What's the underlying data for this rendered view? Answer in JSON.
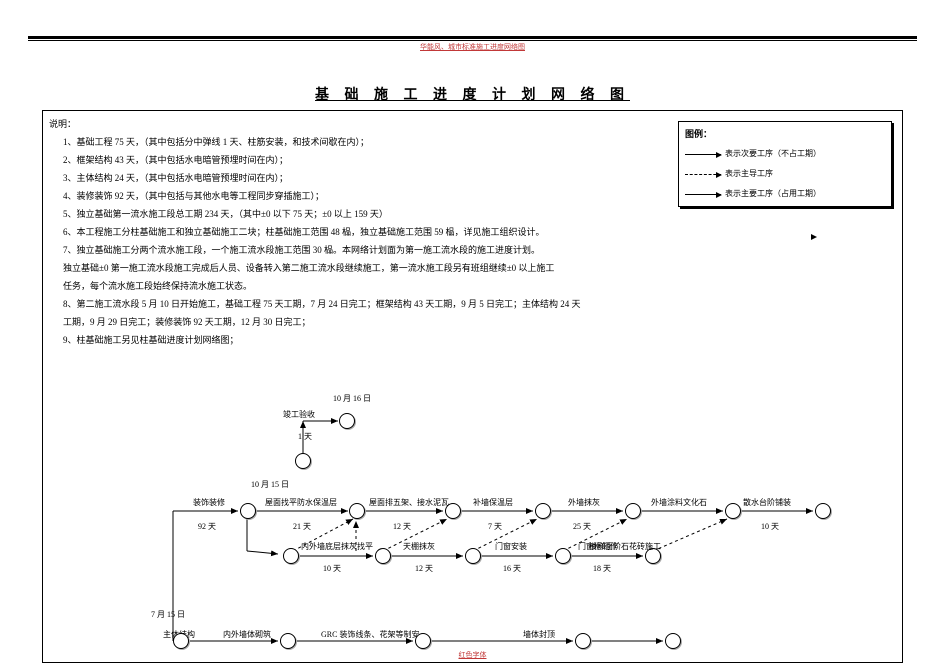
{
  "header_note": "华能风、城市标准施工进度网络图",
  "title": "基 础 施 工 进 度 计 划 网 络 图",
  "explain_label": "说明：",
  "notes": [
    "1、基础工程 75 天，（其中包括分中弹线 1 天、柱筋安装，和技术间歇在内）；",
    "2、框架结构 43 天，（其中包括水电暗管预埋时间在内）；",
    "3、主体结构 24 天，（其中包括水电暗管预埋时间在内）；",
    "4、装修装饰 92 天，（其中包括与其他水电等工程同步穿插施工）；",
    "5、独立基础第一流水施工段总工期 234 天，（其中±0 以下 75 天；±0 以上 159 天）",
    "6、本工程施工分柱基础施工和独立基础施工二块；柱基础施工范围 48 榀，独立基础施工范围 59 榀，详见施工组织设计。",
    "7、独立基础施工分两个流水施工段，一个施工流水段施工范围 30 榀。本网络计划面为第一施工流水段的施工进度计划。",
    "   独立基础±0 第一施工流水段施工完成后人员、设备转入第二施工流水段继续施工，第一流水施工段另有班组继续±0 以上施工",
    "   任务，每个流水施工段始终保持流水施工状态。",
    "8、第二施工流水段 5 月 10 日开始施工，基础工程 75 天工期，7 月 24 日完工；框架结构 43 天工期，9 月 5 日完工；主体结构 24 天",
    "   工期，9 月 29 日完工；装修装饰 92 天工期，12 月 30 日完工；",
    "9、柱基础施工另见柱基础进度计划网络图；"
  ],
  "legend": {
    "title": "图例：",
    "item1": "表示次要工序（不占工期）",
    "item2": "表示主导工序",
    "item3": "表示主要工序（占用工期）"
  },
  "diagram": {
    "date_top": "10 月 16 日",
    "label_top": "竣工验收",
    "dur_top": "1 天",
    "date_mid": "10 月 15 日",
    "row_top": {
      "a0": "装饰装修",
      "d0": "92 天",
      "a1": "屋面找平防水保温层",
      "d1": "21 天",
      "a2": "屋面排五架、接水泥瓦",
      "d2": "12 天",
      "a3": "补墙保温层",
      "d3": "7 天",
      "a4": "外墙抹灰",
      "d4": "25 天",
      "a5": "外墙涂料文化石",
      "d5": "10 天",
      "a6": "散水台阶铺装"
    },
    "row_mid": {
      "a1": "内外墙底层抹灰找平",
      "d1": "10 天",
      "a2": "天棚抹灰",
      "d2": "12 天",
      "a3": "门窗安装",
      "d3": "16 天",
      "a4": "门窗框制作",
      "d4": "18 天",
      "a5": "楼梯面阶石花砖施工",
      "d5": ""
    },
    "date_bottom": "7 月 15 日",
    "row_bot": {
      "a1": "主体结构",
      "a2": "内外墙体砌筑",
      "a3": "GRC 装饰线条、花架等制安",
      "a4": "墙体封顶"
    }
  },
  "footer_note": "红色字体"
}
